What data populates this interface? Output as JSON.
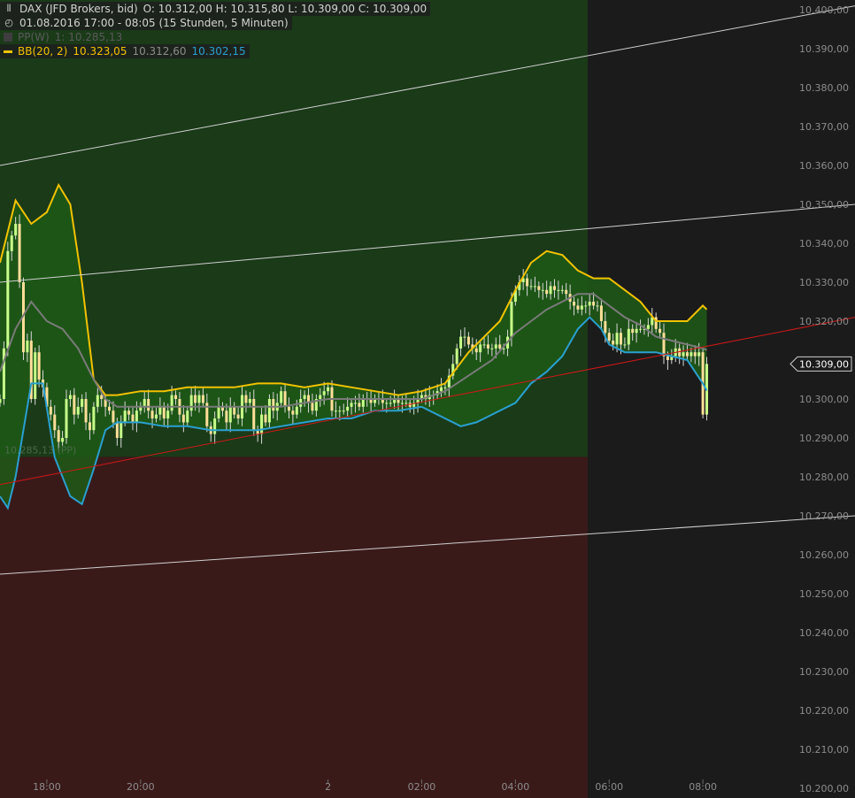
{
  "header": {
    "symbol_icon": "candlestick-icon",
    "title": "DAX (JFD Brokers, bid)",
    "ohlc": "O: 10.312,00  H: 10.315,80  L: 10.309,00  C: 10.309,00",
    "clock_icon": "clock-icon",
    "period": "01.08.2016 17:00 - 08:05 (15 Stunden, 5 Minuten)",
    "pp_label": "PP(W)",
    "pp_values": "1: 10.285,13",
    "bb_label": "BB(20, 2)",
    "bb_upper": "10.323,05",
    "bb_mid": "10.312,60",
    "bb_lower": "10.302,15"
  },
  "pp_marker": "10.285,13 (PP)",
  "price_label": "10.309,00",
  "colors": {
    "background": "#1b1b1b",
    "zone_above_pp": "#1a3a18",
    "zone_below_pp": "#3a1a19",
    "candle_up": "#c8ff8a",
    "candle_down": "#ffdf99",
    "bb_upper": "#f2c200",
    "bb_mid": "#7a7a7a",
    "bb_lower": "#2a9fd0",
    "bb_fill": "#1f5a16",
    "trend_red": "#d01818",
    "channel_lines": "#d0d0d0",
    "axis_text": "#8c8c8c"
  },
  "chart_data": {
    "type": "candlestick",
    "ylim": [
      10200,
      10400
    ],
    "y_ticks": [
      "10.200,00",
      "10.210,00",
      "10.220,00",
      "10.230,00",
      "10.240,00",
      "10.250,00",
      "10.260,00",
      "10.270,00",
      "10.280,00",
      "10.290,00",
      "10.300,00",
      "10.310,00",
      "10.320,00",
      "10.330,00",
      "10.340,00",
      "10.350,00",
      "10.360,00",
      "10.370,00",
      "10.380,00",
      "10.390,00",
      "10.400,00"
    ],
    "y_tick_values": [
      10200,
      10210,
      10220,
      10230,
      10240,
      10250,
      10260,
      10270,
      10280,
      10290,
      10300,
      10310,
      10320,
      10330,
      10340,
      10350,
      10360,
      10370,
      10380,
      10390,
      10400
    ],
    "x_range": [
      "17:00",
      "10:00"
    ],
    "x_ticks": [
      {
        "label": "18:00",
        "t": "18:00"
      },
      {
        "label": "20:00",
        "t": "20:00"
      },
      {
        "label": "2",
        "t": "00:00"
      },
      {
        "label": "02:00",
        "t": "02:00"
      },
      {
        "label": "04:00",
        "t": "04:00"
      },
      {
        "label": "06:00",
        "t": "06:00"
      },
      {
        "label": "08:00",
        "t": "08:00"
      }
    ],
    "last_close": 10309,
    "pivot_point": 10285.13,
    "close_series": [
      [
        "17:00",
        10300
      ],
      [
        "17:05",
        10313
      ],
      [
        "17:10",
        10338
      ],
      [
        "17:15",
        10342
      ],
      [
        "17:20",
        10345
      ],
      [
        "17:25",
        10330
      ],
      [
        "17:30",
        10312
      ],
      [
        "17:35",
        10315
      ],
      [
        "17:40",
        10300
      ],
      [
        "17:45",
        10312
      ],
      [
        "17:50",
        10305
      ],
      [
        "17:55",
        10303
      ],
      [
        "18:00",
        10298
      ],
      [
        "18:05",
        10296
      ],
      [
        "18:10",
        10292
      ],
      [
        "18:15",
        10289
      ],
      [
        "18:20",
        10290
      ],
      [
        "18:25",
        10300
      ],
      [
        "18:30",
        10301
      ],
      [
        "18:35",
        10296
      ],
      [
        "18:40",
        10298
      ],
      [
        "18:45",
        10300
      ],
      [
        "18:50",
        10294
      ],
      [
        "18:55",
        10292
      ],
      [
        "19:00",
        10298
      ],
      [
        "19:05",
        10301
      ],
      [
        "19:10",
        10300
      ],
      [
        "19:15",
        10298
      ],
      [
        "19:20",
        10297
      ],
      [
        "19:25",
        10294
      ],
      [
        "19:30",
        10290
      ],
      [
        "19:35",
        10294
      ],
      [
        "19:40",
        10297
      ],
      [
        "19:45",
        10296
      ],
      [
        "19:50",
        10294
      ],
      [
        "19:55",
        10297
      ],
      [
        "20:00",
        10298
      ],
      [
        "20:05",
        10300
      ],
      [
        "20:10",
        10297
      ],
      [
        "20:15",
        10295
      ],
      [
        "20:20",
        10296
      ],
      [
        "20:25",
        10298
      ],
      [
        "20:30",
        10295
      ],
      [
        "20:35",
        10297
      ],
      [
        "20:40",
        10301
      ],
      [
        "20:45",
        10300
      ],
      [
        "20:50",
        10296
      ],
      [
        "20:55",
        10294
      ],
      [
        "21:00",
        10297
      ],
      [
        "21:05",
        10301
      ],
      [
        "21:10",
        10299
      ],
      [
        "21:15",
        10301
      ],
      [
        "21:20",
        10299
      ],
      [
        "21:25",
        10293
      ],
      [
        "21:30",
        10291
      ],
      [
        "21:35",
        10295
      ],
      [
        "21:40",
        10298
      ],
      [
        "21:45",
        10297
      ],
      [
        "21:50",
        10294
      ],
      [
        "21:55",
        10298
      ],
      [
        "22:00",
        10296
      ],
      [
        "22:05",
        10295
      ],
      [
        "22:10",
        10301
      ],
      [
        "22:15",
        10299
      ],
      [
        "22:20",
        10300
      ],
      [
        "22:25",
        10292
      ],
      [
        "22:30",
        10291
      ],
      [
        "22:35",
        10296
      ],
      [
        "22:40",
        10294
      ],
      [
        "22:45",
        10300
      ],
      [
        "22:50",
        10297
      ],
      [
        "22:55",
        10299
      ],
      [
        "23:00",
        10302
      ],
      [
        "23:05",
        10298
      ],
      [
        "23:10",
        10297
      ],
      [
        "23:15",
        10296
      ],
      [
        "23:20",
        10298
      ],
      [
        "23:25",
        10300
      ],
      [
        "23:30",
        10301
      ],
      [
        "23:35",
        10299
      ],
      [
        "23:40",
        10297
      ],
      [
        "23:45",
        10300
      ],
      [
        "23:50",
        10301
      ],
      [
        "23:55",
        10302
      ],
      [
        "00:00",
        10303
      ],
      [
        "00:05",
        10297
      ],
      [
        "00:10",
        10297
      ],
      [
        "00:15",
        10297
      ],
      [
        "00:20",
        10297
      ],
      [
        "00:25",
        10298
      ],
      [
        "00:30",
        10299
      ],
      [
        "00:35",
        10299
      ],
      [
        "00:40",
        10298
      ],
      [
        "00:45",
        10300
      ],
      [
        "00:50",
        10300
      ],
      [
        "00:55",
        10299
      ],
      [
        "01:00",
        10300
      ],
      [
        "01:05",
        10300
      ],
      [
        "01:10",
        10299
      ],
      [
        "01:15",
        10299
      ],
      [
        "01:20",
        10299
      ],
      [
        "01:25",
        10300
      ],
      [
        "01:30",
        10299
      ],
      [
        "01:35",
        10299
      ],
      [
        "01:40",
        10299
      ],
      [
        "01:45",
        10298
      ],
      [
        "01:50",
        10299
      ],
      [
        "01:55",
        10300
      ],
      [
        "02:00",
        10301
      ],
      [
        "02:05",
        10300
      ],
      [
        "02:10",
        10301
      ],
      [
        "02:15",
        10301
      ],
      [
        "02:20",
        10302
      ],
      [
        "02:25",
        10303
      ],
      [
        "02:30",
        10303
      ],
      [
        "02:35",
        10306
      ],
      [
        "02:40",
        10309
      ],
      [
        "02:45",
        10313
      ],
      [
        "02:50",
        10316
      ],
      [
        "02:55",
        10316
      ],
      [
        "03:00",
        10314
      ],
      [
        "03:05",
        10313
      ],
      [
        "03:10",
        10312
      ],
      [
        "03:15",
        10314
      ],
      [
        "03:20",
        10314
      ],
      [
        "03:25",
        10313
      ],
      [
        "03:30",
        10313
      ],
      [
        "03:35",
        10314
      ],
      [
        "03:40",
        10313
      ],
      [
        "03:45",
        10313
      ],
      [
        "03:50",
        10316
      ],
      [
        "03:55",
        10325
      ],
      [
        "04:00",
        10328
      ],
      [
        "04:05",
        10330
      ],
      [
        "04:10",
        10331
      ],
      [
        "04:15",
        10329
      ],
      [
        "04:20",
        10329
      ],
      [
        "04:25",
        10329
      ],
      [
        "04:30",
        10328
      ],
      [
        "04:35",
        10328
      ],
      [
        "04:40",
        10327
      ],
      [
        "04:45",
        10329
      ],
      [
        "04:50",
        10328
      ],
      [
        "04:55",
        10328
      ],
      [
        "05:00",
        10328
      ],
      [
        "05:05",
        10327
      ],
      [
        "05:10",
        10325
      ],
      [
        "05:15",
        10324
      ],
      [
        "05:20",
        10323
      ],
      [
        "05:25",
        10324
      ],
      [
        "05:30",
        10324
      ],
      [
        "05:35",
        10325
      ],
      [
        "05:40",
        10324
      ],
      [
        "05:45",
        10324
      ],
      [
        "05:50",
        10320
      ],
      [
        "05:55",
        10317
      ],
      [
        "06:00",
        10315
      ],
      [
        "06:05",
        10314
      ],
      [
        "06:10",
        10317
      ],
      [
        "06:15",
        10314
      ],
      [
        "06:20",
        10314
      ],
      [
        "06:25",
        10318
      ],
      [
        "06:30",
        10317
      ],
      [
        "06:35",
        10318
      ],
      [
        "06:40",
        10318
      ],
      [
        "06:45",
        10318
      ],
      [
        "06:50",
        10319
      ],
      [
        "06:55",
        10321
      ],
      [
        "07:00",
        10318
      ],
      [
        "07:05",
        10317
      ],
      [
        "07:10",
        10311
      ],
      [
        "07:15",
        10310
      ],
      [
        "07:20",
        10311
      ],
      [
        "07:25",
        10313
      ],
      [
        "07:30",
        10311
      ],
      [
        "07:35",
        10312
      ],
      [
        "07:40",
        10311
      ],
      [
        "07:45",
        10312
      ],
      [
        "07:50",
        10311
      ],
      [
        "07:55",
        10312
      ],
      [
        "08:00",
        10296
      ],
      [
        "08:05",
        10309
      ]
    ],
    "bollinger": {
      "upper": [
        [
          "17:00",
          10335
        ],
        [
          "17:20",
          10351
        ],
        [
          "17:40",
          10345
        ],
        [
          "18:00",
          10348
        ],
        [
          "18:15",
          10355
        ],
        [
          "18:30",
          10350
        ],
        [
          "18:45",
          10330
        ],
        [
          "19:00",
          10305
        ],
        [
          "19:15",
          10301
        ],
        [
          "19:30",
          10301
        ],
        [
          "20:00",
          10302
        ],
        [
          "20:30",
          10302
        ],
        [
          "21:00",
          10303
        ],
        [
          "21:30",
          10303
        ],
        [
          "22:00",
          10303
        ],
        [
          "22:30",
          10304
        ],
        [
          "23:00",
          10304
        ],
        [
          "23:30",
          10303
        ],
        [
          "00:00",
          10304
        ],
        [
          "00:30",
          10303
        ],
        [
          "01:00",
          10302
        ],
        [
          "01:30",
          10301
        ],
        [
          "02:00",
          10302
        ],
        [
          "02:30",
          10304
        ],
        [
          "03:00",
          10312
        ],
        [
          "03:20",
          10316
        ],
        [
          "03:40",
          10320
        ],
        [
          "04:00",
          10328
        ],
        [
          "04:20",
          10335
        ],
        [
          "04:40",
          10338
        ],
        [
          "05:00",
          10337
        ],
        [
          "05:20",
          10333
        ],
        [
          "05:40",
          10331
        ],
        [
          "06:00",
          10331
        ],
        [
          "06:20",
          10328
        ],
        [
          "06:40",
          10325
        ],
        [
          "07:00",
          10320
        ],
        [
          "07:20",
          10320
        ],
        [
          "07:40",
          10320
        ],
        [
          "08:00",
          10324
        ],
        [
          "08:05",
          10323
        ]
      ],
      "mid": [
        [
          "17:00",
          10307
        ],
        [
          "17:20",
          10318
        ],
        [
          "17:40",
          10325
        ],
        [
          "18:00",
          10320
        ],
        [
          "18:20",
          10318
        ],
        [
          "18:40",
          10313
        ],
        [
          "19:00",
          10305
        ],
        [
          "19:15",
          10300
        ],
        [
          "19:30",
          10298
        ],
        [
          "20:00",
          10298
        ],
        [
          "20:30",
          10298
        ],
        [
          "21:00",
          10298
        ],
        [
          "21:30",
          10298
        ],
        [
          "22:00",
          10298
        ],
        [
          "22:30",
          10298
        ],
        [
          "23:00",
          10298
        ],
        [
          "23:30",
          10299
        ],
        [
          "00:00",
          10300
        ],
        [
          "00:30",
          10300
        ],
        [
          "01:00",
          10300
        ],
        [
          "01:30",
          10300
        ],
        [
          "02:00",
          10300
        ],
        [
          "02:30",
          10302
        ],
        [
          "03:00",
          10306
        ],
        [
          "03:30",
          10310
        ],
        [
          "04:00",
          10317
        ],
        [
          "04:20",
          10320
        ],
        [
          "04:40",
          10323
        ],
        [
          "05:00",
          10325
        ],
        [
          "05:20",
          10327
        ],
        [
          "05:40",
          10327
        ],
        [
          "06:00",
          10324
        ],
        [
          "06:20",
          10321
        ],
        [
          "06:40",
          10319
        ],
        [
          "07:00",
          10316
        ],
        [
          "07:20",
          10315
        ],
        [
          "07:40",
          10314
        ],
        [
          "08:00",
          10313
        ],
        [
          "08:05",
          10312.6
        ]
      ],
      "lower": [
        [
          "17:00",
          10275
        ],
        [
          "17:10",
          10272
        ],
        [
          "17:20",
          10280
        ],
        [
          "17:40",
          10304
        ],
        [
          "17:55",
          10304
        ],
        [
          "18:10",
          10285
        ],
        [
          "18:30",
          10275
        ],
        [
          "18:45",
          10273
        ],
        [
          "19:00",
          10282
        ],
        [
          "19:15",
          10292
        ],
        [
          "19:30",
          10294
        ],
        [
          "20:00",
          10294
        ],
        [
          "20:30",
          10293
        ],
        [
          "21:00",
          10293
        ],
        [
          "21:30",
          10292
        ],
        [
          "22:00",
          10292
        ],
        [
          "22:30",
          10292
        ],
        [
          "23:00",
          10293
        ],
        [
          "23:30",
          10294
        ],
        [
          "00:00",
          10295
        ],
        [
          "00:30",
          10295
        ],
        [
          "01:00",
          10297
        ],
        [
          "01:30",
          10297
        ],
        [
          "02:00",
          10298
        ],
        [
          "02:30",
          10295
        ],
        [
          "02:50",
          10293
        ],
        [
          "03:10",
          10294
        ],
        [
          "03:30",
          10296
        ],
        [
          "03:50",
          10298
        ],
        [
          "04:00",
          10299
        ],
        [
          "04:20",
          10304
        ],
        [
          "04:40",
          10307
        ],
        [
          "05:00",
          10311
        ],
        [
          "05:20",
          10318
        ],
        [
          "05:35",
          10321
        ],
        [
          "05:50",
          10318
        ],
        [
          "06:00",
          10314
        ],
        [
          "06:20",
          10312
        ],
        [
          "06:40",
          10312
        ],
        [
          "07:00",
          10312
        ],
        [
          "07:20",
          10311
        ],
        [
          "07:40",
          10310
        ],
        [
          "08:00",
          10304
        ],
        [
          "08:05",
          10302.15
        ]
      ]
    },
    "trend_line_red": {
      "from": [
        "17:00",
        10278
      ],
      "to": [
        "10:00",
        10321
      ]
    },
    "channel_lines": [
      {
        "from": [
          "17:00",
          10360
        ],
        "to": [
          "10:00",
          10401
        ]
      },
      {
        "from": [
          "17:00",
          10330
        ],
        "to": [
          "10:00",
          10350
        ]
      },
      {
        "from": [
          "17:00",
          10255
        ],
        "to": [
          "10:00",
          10270
        ]
      }
    ],
    "grid": false
  }
}
